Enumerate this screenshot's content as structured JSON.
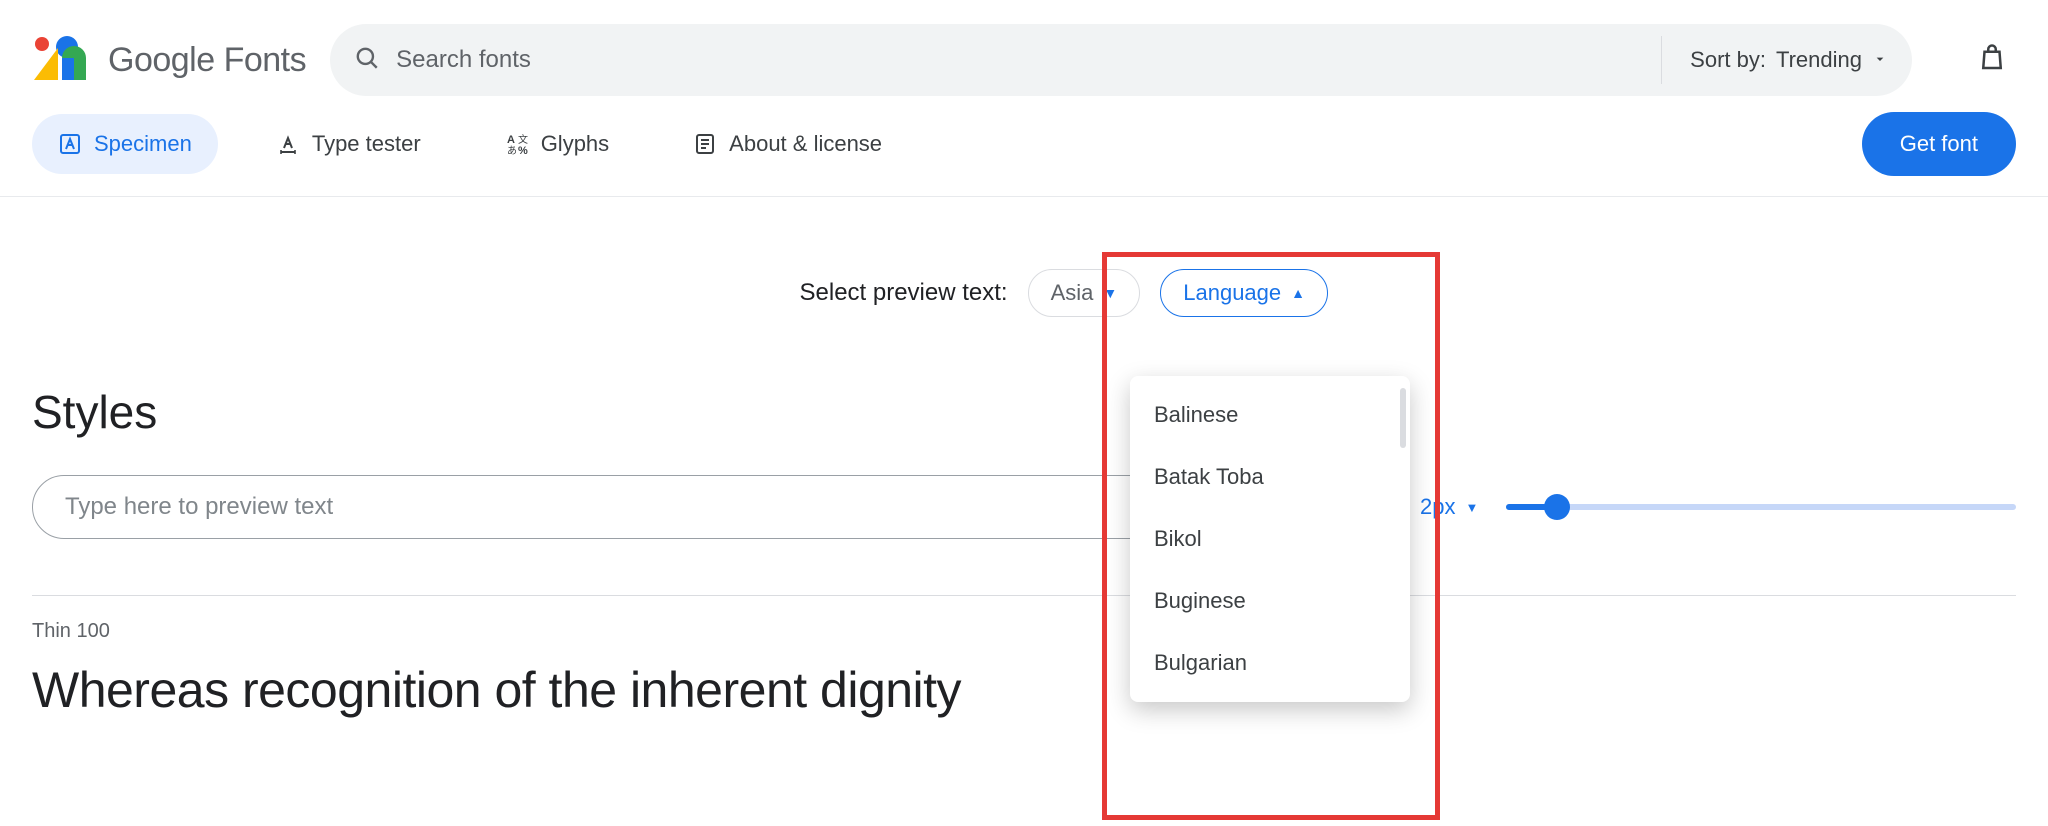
{
  "header": {
    "brand_word1": "Google",
    "brand_word2": "Fonts",
    "search_placeholder": "Search fonts",
    "sort_label": "Sort by:",
    "sort_value": "Trending"
  },
  "tabs": {
    "specimen": "Specimen",
    "type_tester": "Type tester",
    "glyphs": "Glyphs",
    "about": "About & license",
    "get_font": "Get font"
  },
  "preview_select": {
    "label": "Select preview text:",
    "region_chip": "Asia",
    "language_chip": "Language",
    "language_options": [
      "Balinese",
      "Batak Toba",
      "Bikol",
      "Buginese",
      "Bulgarian"
    ]
  },
  "styles": {
    "heading": "Styles",
    "preview_placeholder": "Type here to preview text",
    "size_value": "2px",
    "weight_label": "Thin 100",
    "preview_text": "Whereas recognition of the inherent dignity"
  }
}
